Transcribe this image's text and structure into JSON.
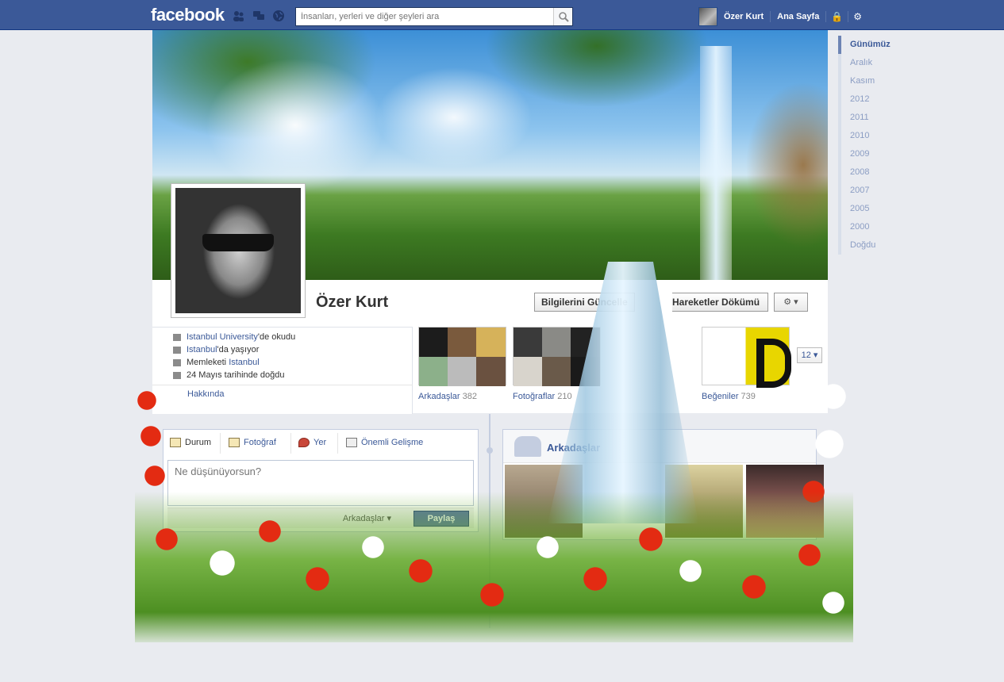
{
  "topbar": {
    "logo": "facebook",
    "search_placeholder": "İnsanları, yerleri ve diğer şeyleri ara",
    "user_name": "Özer Kurt",
    "home_label": "Ana Sayfa",
    "icons": [
      "friend-requests-icon",
      "messages-icon",
      "notifications-globe-icon",
      "privacy-lock-icon",
      "settings-gear-icon",
      "search-icon"
    ]
  },
  "profile": {
    "name": "Özer Kurt",
    "update_info_label": "Bilgilerini Güncelle",
    "activity_log_label": "Hareketler Dökümü",
    "settings_label": "⚙ ▾"
  },
  "info": {
    "school_link": "Istanbul University",
    "school_suffix": "'de okudu",
    "city_link": "Istanbul",
    "city_suffix": "'da yaşıyor",
    "hometown_prefix": "Memleketi ",
    "hometown_link": "Istanbul",
    "birthday": "24 Mayıs tarihinde doğdu",
    "about_link": "Hakkında"
  },
  "tiles": {
    "friends_label": "Arkadaşlar",
    "friends_count": "382",
    "photos_label": "Fotoğraflar",
    "photos_count": "210",
    "likes_label": "Beğeniler",
    "likes_count": "739",
    "more_count": "12 ▾"
  },
  "composer": {
    "tabs": [
      "Durum",
      "Fotoğraf",
      "Yer",
      "Önemli Gelişme"
    ],
    "placeholder": "Ne düşünüyorsun?",
    "privacy_label": "Arkadaşlar ▾",
    "share_label": "Paylaş"
  },
  "friends_box": {
    "title": "Arkadaşlar"
  },
  "years": [
    "Günümüz",
    "Aralık",
    "Kasım",
    "2012",
    "2011",
    "2010",
    "2009",
    "2008",
    "2007",
    "2005",
    "2000",
    "Doğdu"
  ],
  "colors": {
    "brand_blue": "#3b5998",
    "background": "#e9ebf0",
    "link": "#3b5998"
  }
}
